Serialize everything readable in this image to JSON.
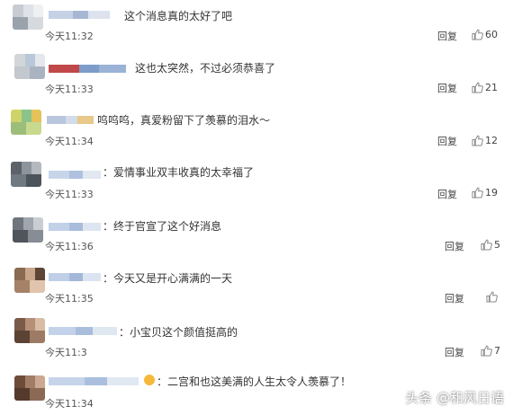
{
  "comments": [
    {
      "time": "今天11:32",
      "text": "这个消息真的太好了吧",
      "reply": "回复",
      "likes": "60",
      "has_emoji": false
    },
    {
      "time": "今天11:33",
      "text": "这也太突然，不过必须恭喜了",
      "reply": "回复",
      "likes": "21",
      "has_emoji": false
    },
    {
      "time": "今天11:34",
      "text": "呜呜呜，真爱粉留下了羡慕的泪水～",
      "reply": "回复",
      "likes": "12",
      "has_emoji": false
    },
    {
      "time": "今天11:33",
      "text": "：爱情事业双丰收真的太幸福了",
      "reply": "回复",
      "likes": "19",
      "has_emoji": false
    },
    {
      "time": "今天11:36",
      "text": "：终于官宣了这个好消息",
      "reply": "回复",
      "likes": "5",
      "has_emoji": false
    },
    {
      "time": "今天11:35",
      "text": "：今天又是开心满满的一天",
      "reply": "回复",
      "likes": "",
      "has_emoji": false
    },
    {
      "time": "今天11:3",
      "text": "：小宝贝这个颜值挺高的",
      "reply": "回复",
      "likes": "7",
      "has_emoji": false
    },
    {
      "time": "今天11:34",
      "text": "：二宫和也这美满的人生太令人羡慕了！",
      "reply": "",
      "likes": "",
      "has_emoji": true
    }
  ],
  "watermark": "头条 @和风日语",
  "colors": {
    "like_icon": "#888888",
    "emoji": "#f5b83a"
  }
}
